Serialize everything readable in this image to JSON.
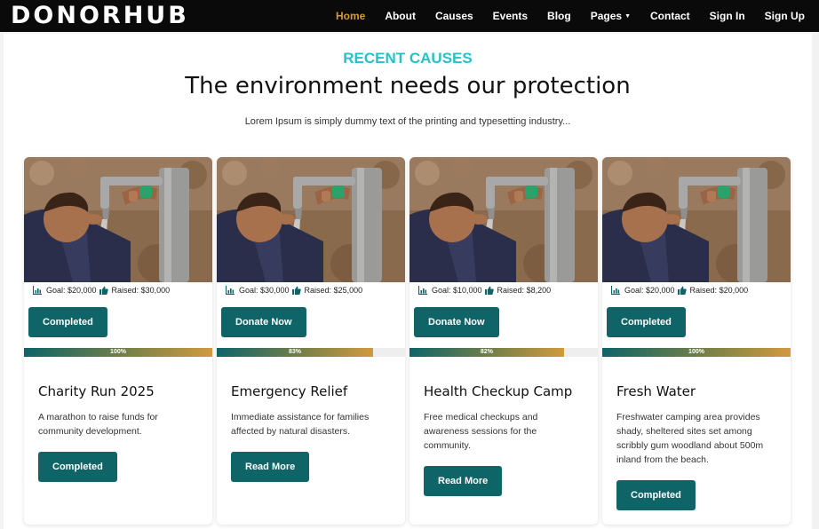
{
  "brand": {
    "logo": "DONORHUB",
    "accent": "#d19a3e",
    "primary": "#0f6468",
    "eyebrow_color": "#23c3c9"
  },
  "nav": {
    "items": [
      {
        "label": "Home",
        "active": true
      },
      {
        "label": "About"
      },
      {
        "label": "Causes"
      },
      {
        "label": "Events"
      },
      {
        "label": "Blog"
      },
      {
        "label": "Pages",
        "dropdown": true
      },
      {
        "label": "Contact"
      },
      {
        "label": "Sign In"
      },
      {
        "label": "Sign Up"
      }
    ]
  },
  "section": {
    "eyebrow": "RECENT CAUSES",
    "title": "The environment needs our protection",
    "subtitle": "Lorem Ipsum is simply dummy text of the printing and typesetting industry..."
  },
  "cards": [
    {
      "goal": "Goal: $20,000",
      "raised": "Raised: $30,000",
      "top_button": "Completed",
      "progress": 100,
      "progress_label": "100%",
      "title": "Charity Run 2025",
      "description": "A marathon to raise funds for community development.",
      "bottom_button": "Completed"
    },
    {
      "goal": "Goal: $30,000",
      "raised": "Raised: $25,000",
      "top_button": "Donate Now",
      "progress": 83,
      "progress_label": "83%",
      "title": "Emergency Relief",
      "description": "Immediate assistance for families affected by natural disasters.",
      "bottom_button": "Read More"
    },
    {
      "goal": "Goal: $10,000",
      "raised": "Raised: $8,200",
      "top_button": "Donate Now",
      "progress": 82,
      "progress_label": "82%",
      "title": "Health Checkup Camp",
      "description": "Free medical checkups and awareness sessions for the community.",
      "bottom_button": "Read More"
    },
    {
      "goal": "Goal: $20,000",
      "raised": "Raised: $20,000",
      "top_button": "Completed",
      "progress": 100,
      "progress_label": "100%",
      "title": "Fresh Water",
      "description": "Freshwater camping area provides shady, sheltered sites set among scribbly gum woodland about 500m inland from the beach.",
      "bottom_button": "Completed"
    }
  ]
}
